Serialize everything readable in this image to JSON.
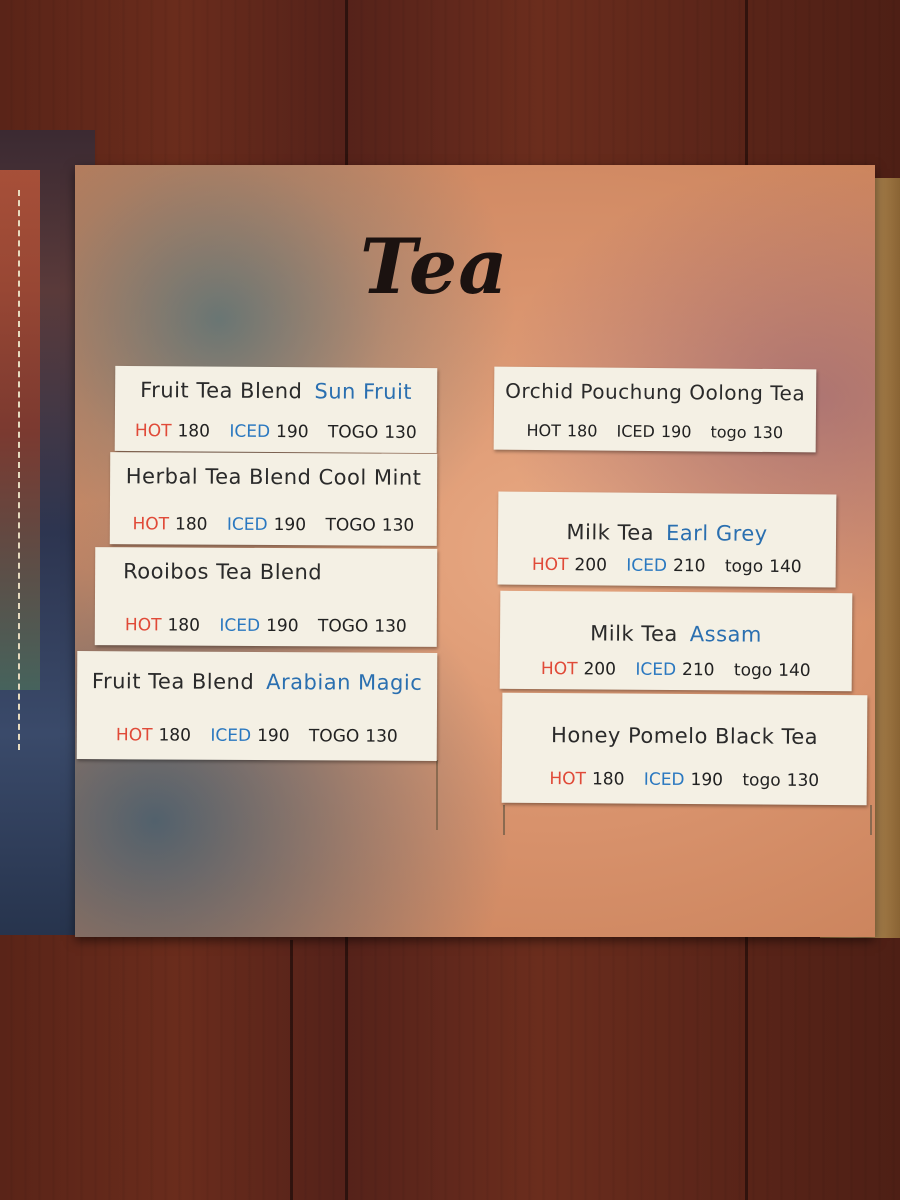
{
  "menu": {
    "title": "Tea",
    "labels": {
      "hot": "HOT",
      "iced": "ICED"
    },
    "left_column": [
      {
        "name": "Fruit Tea Blend",
        "variant": "Sun Fruit",
        "hot": "180",
        "iced": "190",
        "togo_label": "TOGO",
        "togo": "130"
      },
      {
        "name": "Herbal Tea Blend Cool Mint",
        "variant": "",
        "hot": "180",
        "iced": "190",
        "togo_label": "TOGO",
        "togo": "130"
      },
      {
        "name": "Rooibos Tea Blend",
        "variant": "",
        "hot": "180",
        "iced": "190",
        "togo_label": "TOGO",
        "togo": "130"
      },
      {
        "name": "Fruit Tea Blend",
        "variant": "Arabian Magic",
        "hot": "180",
        "iced": "190",
        "togo_label": "TOGO",
        "togo": "130"
      }
    ],
    "right_column": [
      {
        "name": "Orchid Pouchung Oolong Tea",
        "variant": "",
        "hot": "180",
        "iced": "190",
        "togo_label": "togo",
        "togo": "130"
      },
      {
        "name": "Milk Tea",
        "variant": "Earl Grey",
        "hot": "200",
        "iced": "210",
        "togo_label": "togo",
        "togo": "140"
      },
      {
        "name": "Milk Tea",
        "variant": "Assam",
        "hot": "200",
        "iced": "210",
        "togo_label": "togo",
        "togo": "140"
      },
      {
        "name": "Honey Pomelo Black Tea",
        "variant": "",
        "hot": "180",
        "iced": "190",
        "togo_label": "togo",
        "togo": "130"
      }
    ]
  },
  "colors": {
    "hot": "#e04a38",
    "iced": "#2a78c0",
    "variant": "#2a6fb0",
    "card": "#f4f0e4",
    "page": "#d8926c"
  }
}
